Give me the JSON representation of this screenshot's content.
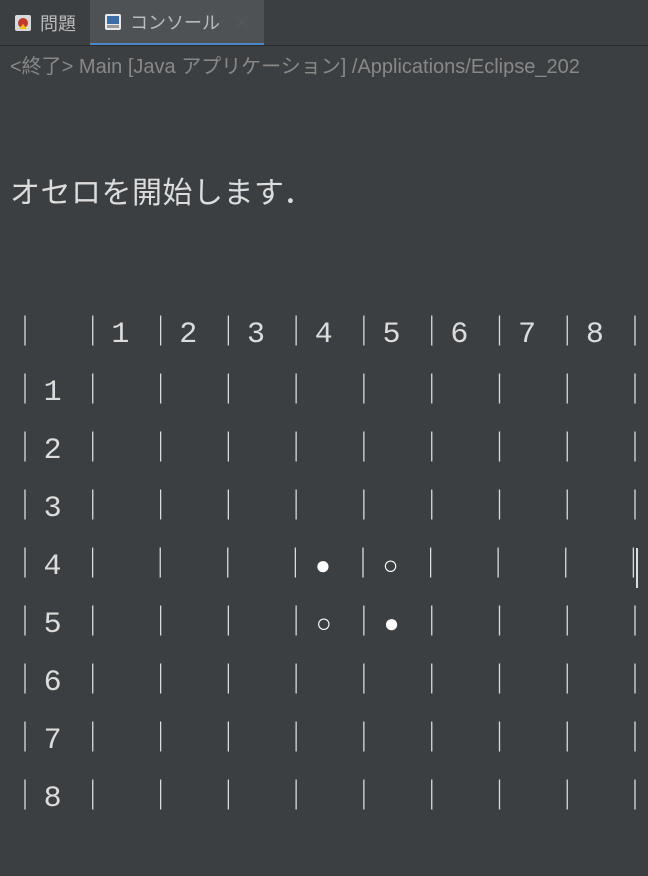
{
  "tabs": {
    "problems": {
      "label": "問題"
    },
    "console": {
      "label": "コンソール"
    }
  },
  "status": {
    "terminated": "<終了>",
    "process": "Main [Java アプリケーション] /Applications/Eclipse_202"
  },
  "output": {
    "start_message": "オセロを開始します．",
    "header_cols": [
      "",
      "1",
      "2",
      "3",
      "4",
      "5",
      "6",
      "7",
      "8"
    ],
    "rows": [
      {
        "label": "1",
        "cells": [
          "",
          "",
          "",
          "",
          "",
          "",
          "",
          ""
        ]
      },
      {
        "label": "2",
        "cells": [
          "",
          "",
          "",
          "",
          "",
          "",
          "",
          ""
        ]
      },
      {
        "label": "3",
        "cells": [
          "",
          "",
          "",
          "",
          "",
          "",
          "",
          ""
        ]
      },
      {
        "label": "4",
        "cells": [
          "",
          "",
          "",
          "●",
          "○",
          "",
          "",
          ""
        ]
      },
      {
        "label": "5",
        "cells": [
          "",
          "",
          "",
          "○",
          "●",
          "",
          "",
          ""
        ]
      },
      {
        "label": "6",
        "cells": [
          "",
          "",
          "",
          "",
          "",
          "",
          "",
          ""
        ]
      },
      {
        "label": "7",
        "cells": [
          "",
          "",
          "",
          "",
          "",
          "",
          "",
          ""
        ]
      },
      {
        "label": "8",
        "cells": [
          "",
          "",
          "",
          "",
          "",
          "",
          "",
          ""
        ]
      }
    ],
    "cursor_row": 3
  }
}
